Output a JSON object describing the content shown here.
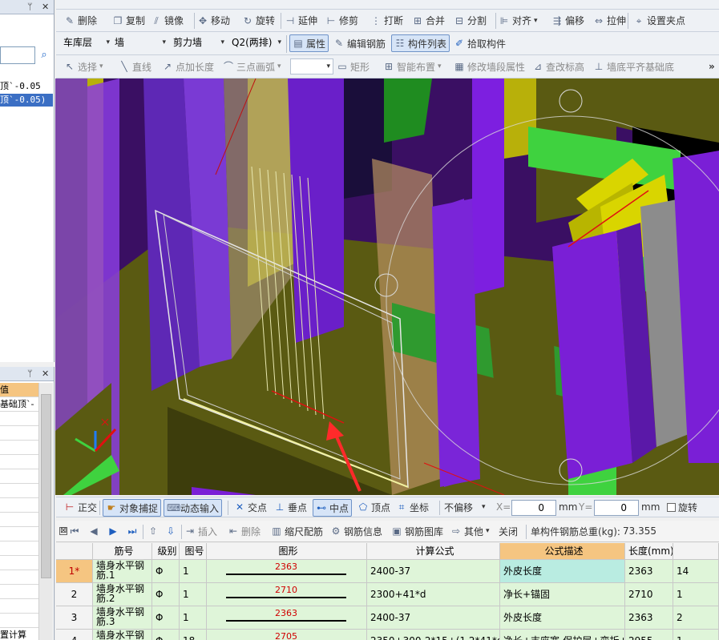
{
  "left_panel": {
    "tree_items": [
      "顶`-0.05",
      "顶`-0.05)"
    ],
    "bottom_header": "值",
    "bottom_rows": [
      "基础顶`-",
      "",
      "",
      "",
      "",
      "",
      "",
      "",
      "",
      "",
      "",
      "",
      "",
      "",
      "",
      "",
      "置计算",
      "置计算"
    ]
  },
  "toolbar_edit": {
    "items": [
      "删除",
      "复制",
      "镜像",
      "移动",
      "旋转",
      "延伸",
      "修剪",
      "打断",
      "合并",
      "分割",
      "对齐",
      "偏移",
      "拉伸",
      "设置夹点"
    ]
  },
  "toolbar_floor": {
    "floor": "车库层",
    "category": "墙",
    "type": "剪力墙",
    "element": "Q2(两排)",
    "properties": "属性",
    "edit_rebar": "编辑钢筋",
    "component_list": "构件列表",
    "pick": "拾取构件"
  },
  "toolbar_draw": {
    "select": "选择",
    "line": "直线",
    "point_length": "点加长度",
    "arc": "三点画弧",
    "arc_combo": "",
    "rect": "矩形",
    "smart_layout": "智能布置",
    "modify_wall_attr": "修改墙段属性",
    "check_elevation": "查改标高",
    "align_bottom": "墙底平齐基础底",
    "more": "»"
  },
  "snap_bar": {
    "ortho": "正交",
    "snap": "对象捕捉",
    "dyn_input": "动态输入",
    "intersection": "交点",
    "perpendicular": "垂点",
    "midpoint": "中点",
    "vertex": "顶点",
    "coordinate": "坐标",
    "offset_mode": "不偏移",
    "x_label": "X=",
    "x_value": "0",
    "x_unit": "mm",
    "y_label": "Y=",
    "y_value": "0",
    "y_unit": "mm",
    "rotate": "旋转"
  },
  "rebar_bar": {
    "insert": "插入",
    "delete": "删除",
    "scale_rebar": "缩尺配筋",
    "rebar_info": "钢筋信息",
    "rebar_library": "钢筋图库",
    "other": "其他",
    "close": "关闭",
    "total_weight_label": "单构件钢筋总重(kg):",
    "total_weight": "73.355"
  },
  "table": {
    "headers": [
      "",
      "筋号",
      "级别",
      "图号",
      "图形",
      "计算公式",
      "公式描述",
      "长度(mm)",
      ""
    ],
    "rows": [
      {
        "idx": "1*",
        "name": "墙身水平钢筋.1",
        "grade": "Φ",
        "fig": "1",
        "shape_val": "2363",
        "formula": "2400-37",
        "desc": "外皮长度",
        "length": "2363",
        "count": "14"
      },
      {
        "idx": "2",
        "name": "墙身水平钢筋.2",
        "grade": "Φ",
        "fig": "1",
        "shape_val": "2710",
        "formula": "2300+41*d",
        "desc": "净长+锚固",
        "length": "2710",
        "count": "1"
      },
      {
        "idx": "3",
        "name": "墙身水平钢筋.3",
        "grade": "Φ",
        "fig": "1",
        "shape_val": "2363",
        "formula": "2400-37",
        "desc": "外皮长度",
        "length": "2363",
        "count": "2"
      },
      {
        "idx": "4",
        "name": "墙身水平钢",
        "grade": "Φ",
        "fig": "18",
        "shape_val": "2705",
        "formula": "2350+300-2*15+(1.2*41*d...",
        "desc": "净长+支座宽-保护层+弯折+",
        "length": "2955",
        "count": "1"
      }
    ]
  },
  "colors": {
    "purple": "#7a1fd6",
    "green": "#3fd23f",
    "yellow": "#d9d500",
    "olive": "#5a5a12",
    "selected_highlight": "#b9ece1",
    "row_bg": "#dff5d9",
    "header_highlight": "#f5c581"
  }
}
